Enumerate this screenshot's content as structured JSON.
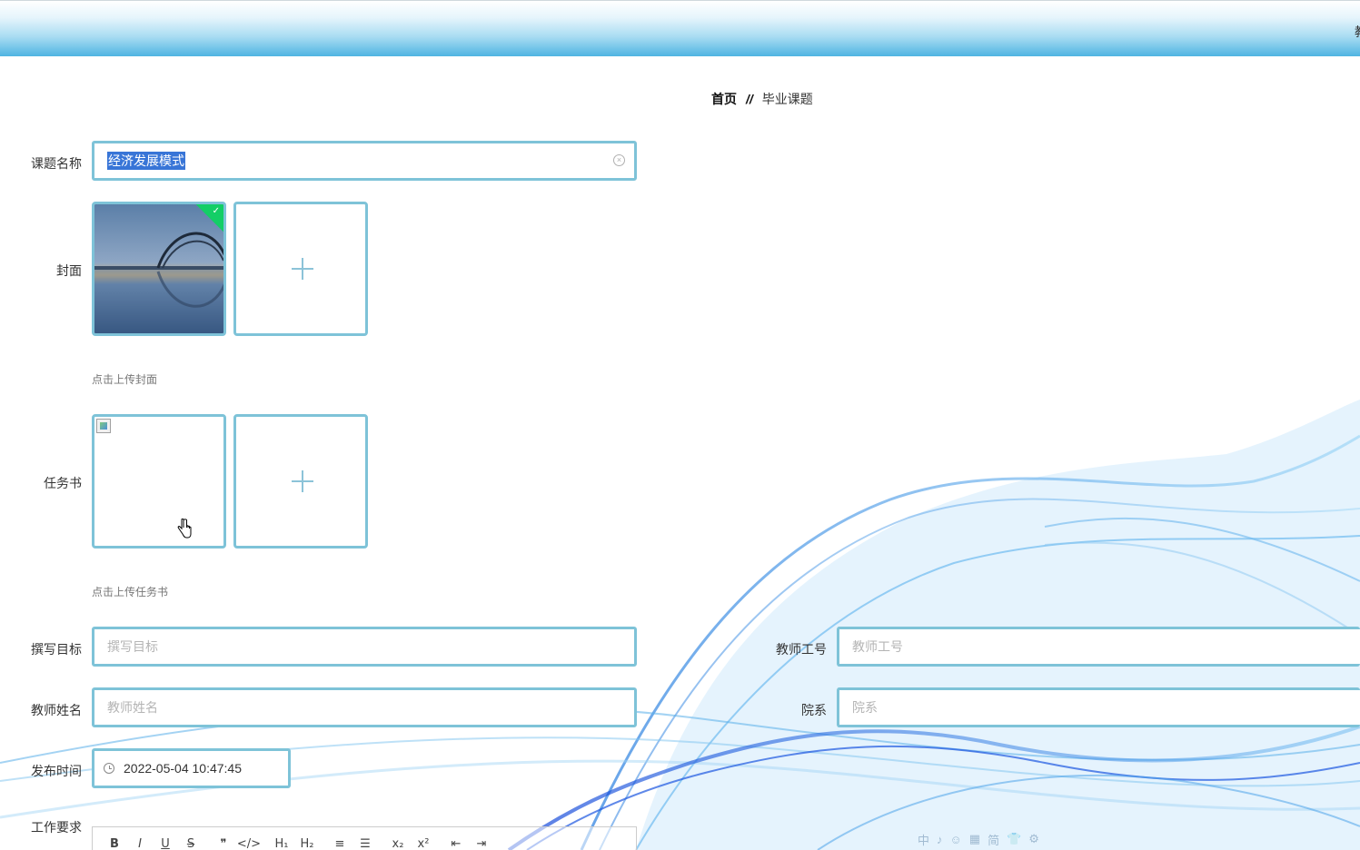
{
  "header": {
    "edge_text": "教"
  },
  "breadcrumb": {
    "home": "首页",
    "separator": "//",
    "current": "毕业课题"
  },
  "form": {
    "title": {
      "label": "课题名称",
      "value": "经济发展模式"
    },
    "cover": {
      "label": "封面",
      "hint": "点击上传封面"
    },
    "task_book": {
      "label": "任务书",
      "hint": "点击上传任务书"
    },
    "writing_goal": {
      "label": "撰写目标",
      "placeholder": "撰写目标"
    },
    "teacher_id": {
      "label": "教师工号",
      "placeholder": "教师工号"
    },
    "teacher_name": {
      "label": "教师姓名",
      "placeholder": "教师姓名"
    },
    "department": {
      "label": "院系",
      "placeholder": "院系"
    },
    "publish_time": {
      "label": "发布时间",
      "value": "2022-05-04 10:47:45"
    },
    "work_requirements": {
      "label": "工作要求"
    }
  },
  "editor_toolbar": [
    "B",
    "I",
    "U",
    "S",
    "❞",
    "</>",
    "H₁",
    "H₂",
    "≡",
    "☰",
    "x₂",
    "x²",
    "⇤",
    "⇥"
  ],
  "ime_bar": [
    "中",
    "♪",
    "☺",
    "▦",
    "简",
    "👕",
    "⚙"
  ],
  "colors": {
    "accent_border": "#7ec3d8",
    "header_gradient_end": "#4fb4e2",
    "wave_blue": "#3a8fe6",
    "success_badge": "#13ce66"
  }
}
